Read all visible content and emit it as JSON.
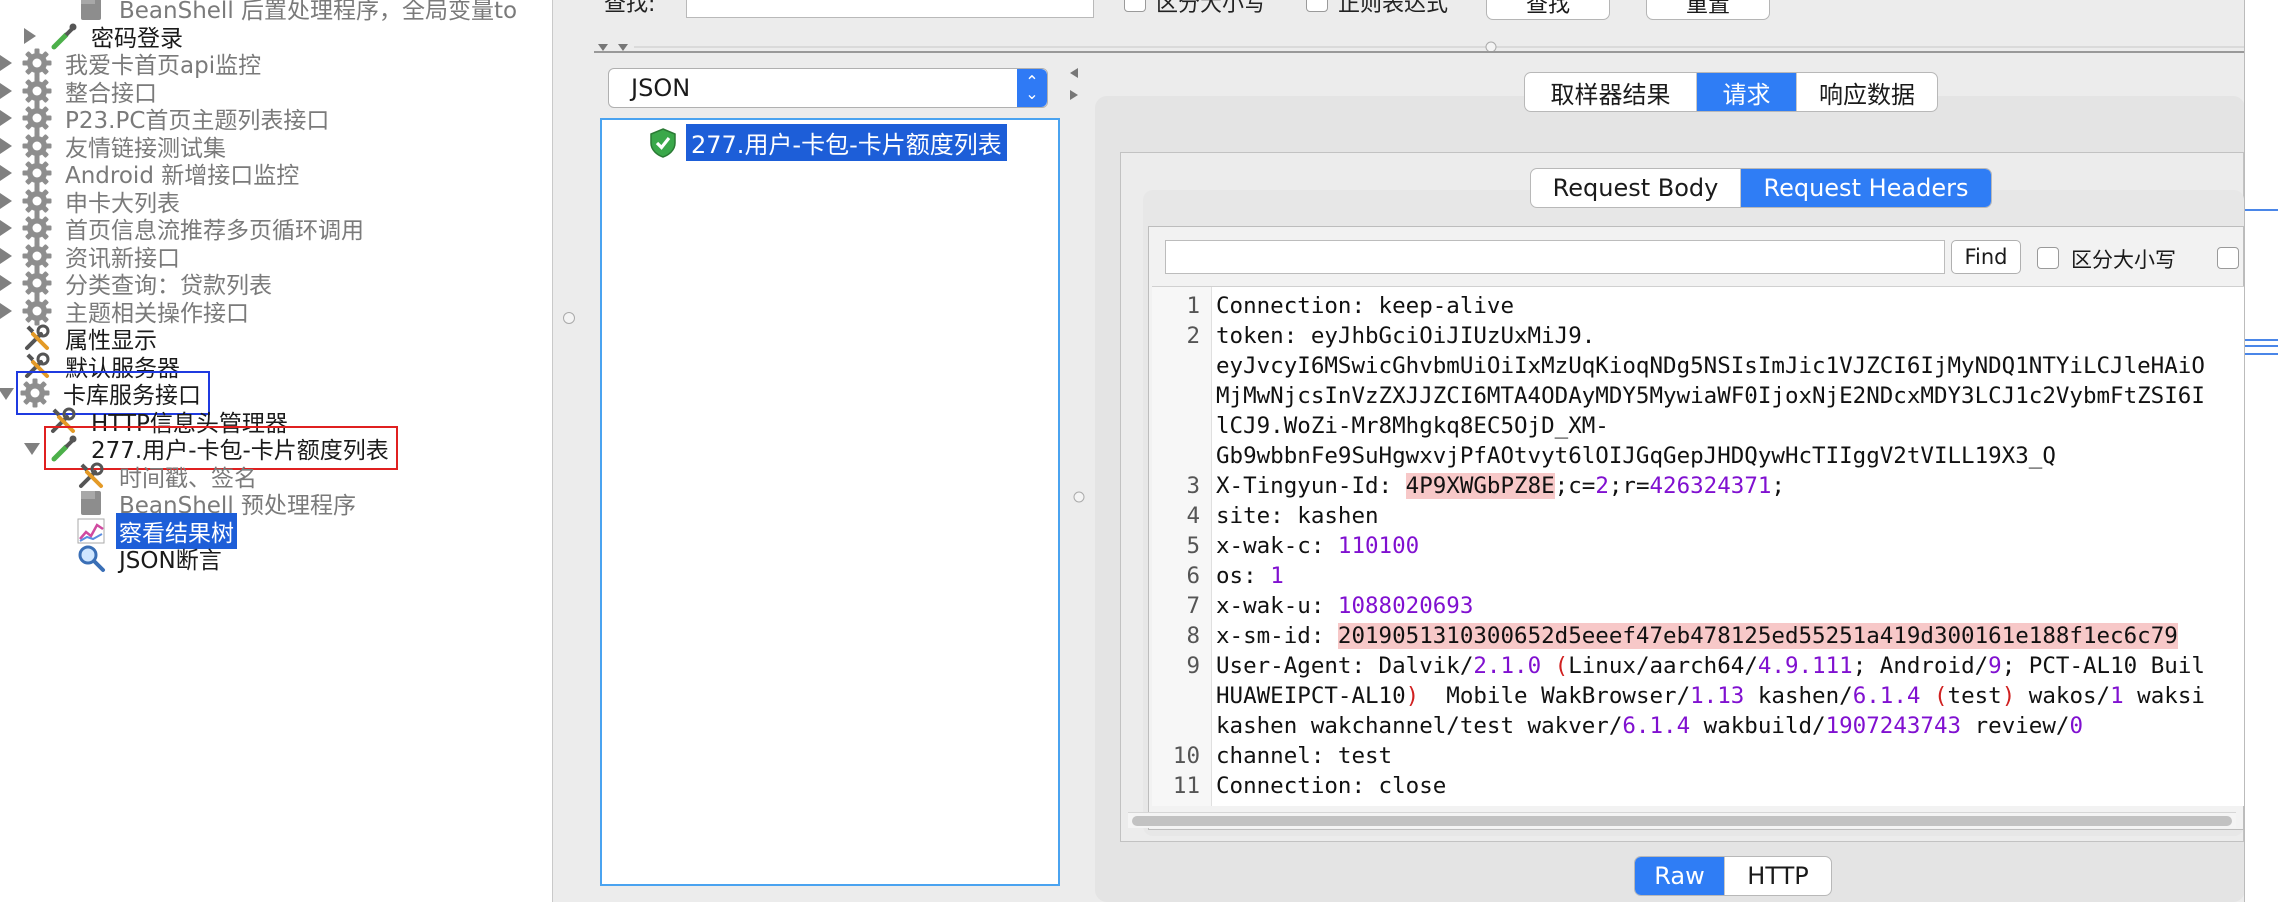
{
  "tree": {
    "items": [
      {
        "label": "BeanShell 后置处理程序，全局变量to",
        "icon": "beanshell-icon",
        "indent": 2,
        "state": "disabled-partial"
      },
      {
        "label": "密码登录",
        "icon": "pipette-icon",
        "indent": 1,
        "state": "normal",
        "twisty": "right"
      },
      {
        "label": "我爱卡首页api监控",
        "icon": "gear-icon",
        "indent": 0,
        "state": "disabled",
        "twisty": "right"
      },
      {
        "label": "整合接口",
        "icon": "gear-icon",
        "indent": 0,
        "state": "disabled",
        "twisty": "right"
      },
      {
        "label": "P23.PC首页主题列表接口",
        "icon": "gear-icon",
        "indent": 0,
        "state": "disabled",
        "twisty": "right"
      },
      {
        "label": "友情链接测试集",
        "icon": "gear-icon",
        "indent": 0,
        "state": "disabled",
        "twisty": "right"
      },
      {
        "label": "Android 新增接口监控",
        "icon": "gear-icon",
        "indent": 0,
        "state": "disabled",
        "twisty": "right"
      },
      {
        "label": "申卡大列表",
        "icon": "gear-icon",
        "indent": 0,
        "state": "disabled",
        "twisty": "right"
      },
      {
        "label": "首页信息流推荐多页循环调用",
        "icon": "gear-icon",
        "indent": 0,
        "state": "disabled",
        "twisty": "right"
      },
      {
        "label": "资讯新接口",
        "icon": "gear-icon",
        "indent": 0,
        "state": "disabled",
        "twisty": "right"
      },
      {
        "label": "分类查询：贷款列表",
        "icon": "gear-icon",
        "indent": 0,
        "state": "disabled",
        "twisty": "right"
      },
      {
        "label": "主题相关操作接口",
        "icon": "gear-icon",
        "indent": 0,
        "state": "disabled",
        "twisty": "right"
      },
      {
        "label": "属性显示",
        "icon": "wrench-icon",
        "indent": 0,
        "state": "normal"
      },
      {
        "label": "默认服务器",
        "icon": "wrench-icon",
        "indent": 0,
        "state": "normal"
      },
      {
        "label": "卡库服务接口",
        "icon": "gear-icon",
        "indent": 0,
        "state": "boxed-blue",
        "twisty": "down"
      },
      {
        "label": "HTTP信息头管理器",
        "icon": "wrench-icon",
        "indent": 1,
        "state": "normal"
      },
      {
        "label": "277.用户-卡包-卡片额度列表",
        "icon": "pipette-icon",
        "indent": 1,
        "state": "boxed-red",
        "twisty": "down"
      },
      {
        "label": "时间戳、签名",
        "icon": "wrench-icon",
        "indent": 2,
        "state": "disabled"
      },
      {
        "label": "BeanShell 预处理程序",
        "icon": "beanshell-icon",
        "indent": 2,
        "state": "disabled"
      },
      {
        "label": "察看结果树",
        "icon": "chart-icon",
        "indent": 2,
        "state": "selected"
      },
      {
        "label": "JSON断言",
        "icon": "magnifier-icon",
        "indent": 2,
        "state": "normal"
      }
    ]
  },
  "search": {
    "label": "查找:",
    "case_label": "区分大小写",
    "regex_label": "正则表达式",
    "find_button": "查找",
    "reset_button": "重置"
  },
  "renderer": {
    "selected": "JSON"
  },
  "results": {
    "item": "277.用户-卡包-卡片额度列表",
    "status": "success"
  },
  "tabs": {
    "labels": [
      "取样器结果",
      "请求",
      "响应数据"
    ],
    "active": 1
  },
  "subtabs": {
    "labels": [
      "Request Body",
      "Request Headers"
    ],
    "active": 1
  },
  "find": {
    "value": "",
    "button": "Find",
    "case_label": "区分大小写"
  },
  "editor": {
    "lines": [
      {
        "no": "1",
        "text": "Connection: keep-alive"
      },
      {
        "no": "2",
        "text": "token: eyJhbGciOiJIUzUxMiJ9."
      },
      {
        "no": "",
        "text": "eyJvcyI6MSwicGhvbmUiOiIxMzUqKioqNDg5NSIsImJic1VJZCI6IjMyNDQ1NTYiLCJleHAiO"
      },
      {
        "no": "",
        "text": "MjMwNjcsInVzZXJJZCI6MTA4ODAyMDY5MywiaWF0IjoxNjE2NDcxMDY3LCJ1c2VybmFtZSI6I"
      },
      {
        "no": "",
        "text": "lCJ9.WoZi-Mr8Mhgkq8EC5OjD_XM-"
      },
      {
        "no": "",
        "text": "Gb9wbbnFe9SuHgwxvjPfAOtvyt6lOIJGqGepJHDQywHcTIIggV2tVILL19X3_Q"
      },
      {
        "no": "3",
        "text": "X-Tingyun-Id: 4P9XWGbPZ8E;c=2;r=426324371;"
      },
      {
        "no": "4",
        "text": "site: kashen"
      },
      {
        "no": "5",
        "text": "x-wak-c: 110100"
      },
      {
        "no": "6",
        "text": "os: 1"
      },
      {
        "no": "7",
        "text": "x-wak-u: 1088020693"
      },
      {
        "no": "8",
        "text": "x-sm-id: 2019051310300652d5eeef47eb478125ed55251a419d300161e188f1ec6c79"
      },
      {
        "no": "9",
        "text": "User-Agent: Dalvik/2.1.0 (Linux/aarch64/4.9.111; Android/9; PCT-AL10 Buil"
      },
      {
        "no": "",
        "text": "HUAWEIPCT-AL10)  Mobile WakBrowser/1.13 kashen/6.1.4 (test) wakos/1 waksi"
      },
      {
        "no": "",
        "text": "kashen wakchannel/test wakver/6.1.4 wakbuild/1907243743 review/0"
      },
      {
        "no": "10",
        "text": "channel: test"
      },
      {
        "no": "11",
        "text": "Connection: close"
      }
    ]
  },
  "bottom_tabs": {
    "labels": [
      "Raw",
      "HTTP"
    ],
    "active": 0
  },
  "colors": {
    "accent": "#2f7df5",
    "selection": "#1d5ed8",
    "number": "#8010d0",
    "highlight": "#f7c8c8"
  }
}
